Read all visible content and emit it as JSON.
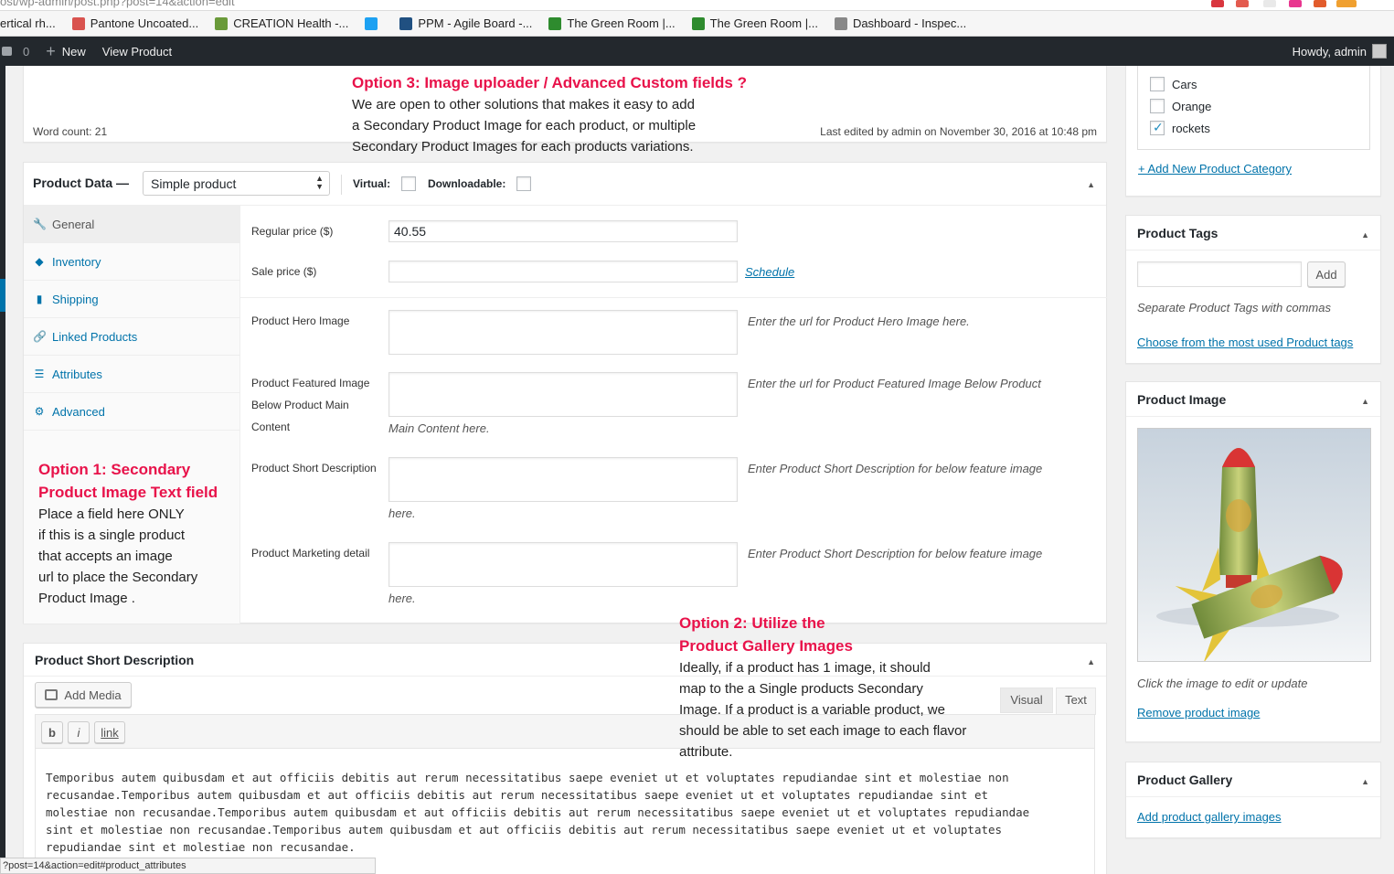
{
  "browser": {
    "url_fragment": "ost/wp-admin/post.php?post=14&action=edit",
    "bookmarks": [
      {
        "label": "ertical rh...",
        "icon": "blank-icon",
        "color": "#f6f6f6"
      },
      {
        "label": "Pantone Uncoated...",
        "icon": "pantone-icon",
        "color": "#d9534f"
      },
      {
        "label": "CREATION Health -...",
        "icon": "leaf-icon",
        "color": "#6a9a3a"
      },
      {
        "label": "",
        "icon": "twitter-icon",
        "color": "#1da1f2"
      },
      {
        "label": "PPM - Agile Board -...",
        "icon": "jira-icon",
        "color": "#205081"
      },
      {
        "label": "The Green Room |...",
        "icon": "greenroom-icon",
        "color": "#2e8b2e"
      },
      {
        "label": "The Green Room |...",
        "icon": "greenroom-icon",
        "color": "#2e8b2e"
      },
      {
        "label": "Dashboard - Inspec...",
        "icon": "magnifier-icon",
        "color": "#888888"
      }
    ]
  },
  "adminbar": {
    "comments_count": "0",
    "new_label": "New",
    "view_label": "View Product",
    "howdy": "Howdy, admin"
  },
  "editor_footer": {
    "word_count": "Word count: 21",
    "last_edited": "Last edited by admin on November 30, 2016 at 10:48 pm"
  },
  "annotations": {
    "option3_title": "Option 3: Image uploader / Advanced Custom fields ?",
    "option3_body": [
      "We are open to other solutions that makes it easy  to add",
      "a Secondary Product Image for each product, or multiple",
      "Secondary Product Images for each products variations."
    ],
    "option1_title": [
      "Option 1: Secondary",
      "Product Image Text field"
    ],
    "option1_body": [
      "Place a field here ONLY",
      "if this is a single product",
      "that accepts an image",
      "url to place the Secondary",
      "Product Image ."
    ],
    "option2_title": [
      "Option 2: Utilize the",
      "Product Gallery Images"
    ],
    "option2_body": [
      "Ideally, if a product has 1 image, it should",
      "map to the a Single products Secondary",
      "Image. If a product is a variable product, we",
      "should be able to set each image to each flavor",
      "attribute."
    ]
  },
  "product_data": {
    "title": "Product Data —",
    "type_selected": "Simple product",
    "virtual_label": "Virtual:",
    "downloadable_label": "Downloadable:",
    "tabs": [
      {
        "label": "General",
        "icon": "wrench-icon",
        "glyph": "🔧"
      },
      {
        "label": "Inventory",
        "icon": "tag-icon",
        "glyph": "◆"
      },
      {
        "label": "Shipping",
        "icon": "truck-icon",
        "glyph": "▮"
      },
      {
        "label": "Linked Products",
        "icon": "link-icon",
        "glyph": "🔗"
      },
      {
        "label": "Attributes",
        "icon": "list-icon",
        "glyph": "☰"
      },
      {
        "label": "Advanced",
        "icon": "gear-icon",
        "glyph": "⚙"
      }
    ],
    "regular_price_label": "Regular price ($)",
    "regular_price_value": "40.55",
    "sale_price_label": "Sale price ($)",
    "sale_price_value": "",
    "schedule_link": "Schedule",
    "hero_label": "Product Hero Image",
    "hero_desc": "Enter the url for Product Hero Image here.",
    "featured_label": [
      "Product Featured Image",
      "Below Product Main",
      "Content"
    ],
    "featured_desc": "Enter the url for Product Featured Image Below Product",
    "featured_desc2": "Main Content here.",
    "short_desc_label": "Product Short Description",
    "short_desc_desc": "Enter Product Short Description for below feature image",
    "short_desc_desc2": "here.",
    "marketing_label": "Product Marketing detail",
    "marketing_desc": "Enter Product Short Description for below feature image",
    "marketing_desc2": "here."
  },
  "short_description_box": {
    "title": "Product Short Description",
    "add_media": "Add Media",
    "visual_tab": "Visual",
    "text_tab": "Text",
    "qt_bold": "b",
    "qt_italic": "i",
    "qt_link": "link",
    "content": [
      "Temporibus autem quibusdam et aut officiis debitis aut rerum necessitatibus saepe eveniet ut et voluptates repudiandae sint et molestiae non",
      "recusandae.Temporibus autem quibusdam et aut officiis debitis aut rerum necessitatibus saepe eveniet ut et voluptates repudiandae sint et",
      "molestiae non recusandae.Temporibus autem quibusdam et aut officiis debitis aut rerum necessitatibus saepe eveniet ut et voluptates repudiandae",
      "sint et molestiae non recusandae.Temporibus autem quibusdam et aut officiis debitis aut rerum necessitatibus saepe eveniet ut et voluptates",
      "repudiandae sint et molestiae non recusandae."
    ]
  },
  "categories": {
    "items": [
      {
        "label": "Cars",
        "checked": false
      },
      {
        "label": "Orange",
        "checked": false
      },
      {
        "label": "rockets",
        "checked": true
      }
    ],
    "add_new": "+ Add New Product Category"
  },
  "tags_box": {
    "title": "Product Tags",
    "add_button": "Add",
    "input_value": "",
    "hint": "Separate Product Tags with commas",
    "choose_link": "Choose from the most used Product tags"
  },
  "image_box": {
    "title": "Product Image",
    "hint": "Click the image to edit or update",
    "remove_link": "Remove product image"
  },
  "gallery_box": {
    "title": "Product Gallery",
    "add_link": "Add product gallery images"
  },
  "status_bar": {
    "text": "?post=14&action=edit#product_attributes"
  },
  "colors": {
    "adminbar": "#23282d",
    "link": "#0073aa",
    "annotation": "#e8124a"
  }
}
